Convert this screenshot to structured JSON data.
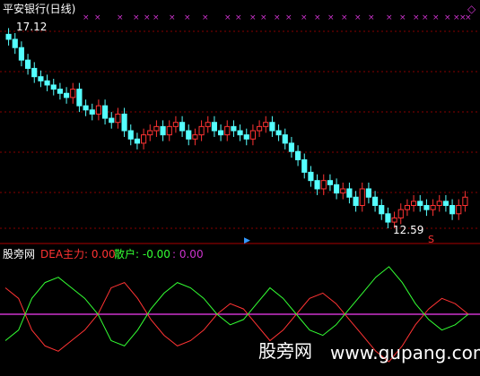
{
  "panel_top": {
    "title": "平安银行(日线)",
    "title_color": "#ffffff",
    "high_marker": "17.12",
    "low_marker": "12.59",
    "signal_right": "◇",
    "bottom_marker_s": "S",
    "signal_color": "#cc33cc"
  },
  "panel_bottom": {
    "indicator_name": "股旁网",
    "dea_label": "DEA主力: 0.00",
    "sanhu_label": "散户: -0.00",
    "extra_value": ": 0.00",
    "dea_color": "#ff3333",
    "sanhu_color": "#33ff33",
    "extra_color": "#cc33cc"
  },
  "watermark": {
    "text_cn": "股旁网",
    "text_url": "www.gupang.com"
  },
  "chart_data": {
    "type": "candlestick",
    "series": [
      {
        "name": "K线",
        "close": [
          17.0,
          16.8,
          16.5,
          16.3,
          16.1,
          16.0,
          15.9,
          15.8,
          15.7,
          15.6,
          15.8,
          15.4,
          15.3,
          15.2,
          15.4,
          15.1,
          15.0,
          15.2,
          14.8,
          14.6,
          14.5,
          14.7,
          14.8,
          14.9,
          14.7,
          14.9,
          15.0,
          14.8,
          14.6,
          14.7,
          14.9,
          15.0,
          14.8,
          14.7,
          14.9,
          14.8,
          14.7,
          14.6,
          14.8,
          14.9,
          15.0,
          14.8,
          14.7,
          14.5,
          14.3,
          14.1,
          13.8,
          13.6,
          13.4,
          13.6,
          13.5,
          13.3,
          13.4,
          13.2,
          13.0,
          13.4,
          13.2,
          13.0,
          12.8,
          12.6,
          12.7,
          12.9,
          13.0,
          13.1,
          13.0,
          12.9,
          13.0,
          13.1,
          13.0,
          12.8,
          13.0,
          13.2
        ]
      },
      {
        "name": "DEA主力",
        "values": [
          0.5,
          0.3,
          -0.3,
          -0.6,
          -0.7,
          -0.5,
          -0.3,
          0.0,
          0.5,
          0.6,
          0.3,
          -0.1,
          -0.4,
          -0.6,
          -0.5,
          -0.3,
          0.0,
          0.2,
          0.1,
          -0.2,
          -0.5,
          -0.3,
          0.0,
          0.3,
          0.4,
          0.2,
          -0.1,
          -0.4,
          -0.7,
          -0.9,
          -0.6,
          -0.2,
          0.1,
          0.3,
          0.2,
          0.0
        ]
      },
      {
        "name": "散户",
        "values": [
          -0.5,
          -0.3,
          0.3,
          0.6,
          0.7,
          0.5,
          0.3,
          0.0,
          -0.5,
          -0.6,
          -0.3,
          0.1,
          0.4,
          0.6,
          0.5,
          0.3,
          0.0,
          -0.2,
          -0.1,
          0.2,
          0.5,
          0.3,
          0.0,
          -0.3,
          -0.4,
          -0.2,
          0.1,
          0.4,
          0.7,
          0.9,
          0.6,
          0.2,
          -0.1,
          -0.3,
          -0.2,
          0.0
        ]
      }
    ],
    "ylim_price": [
      12.3,
      17.3
    ],
    "ylim_indicator": [
      -1,
      1
    ]
  }
}
